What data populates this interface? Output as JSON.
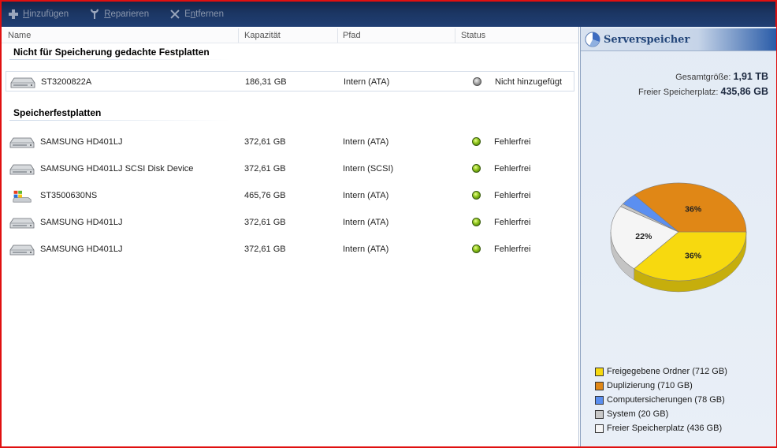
{
  "toolbar": {
    "add": {
      "pre": "",
      "u": "H",
      "post": "inzufügen"
    },
    "repair": {
      "pre": "",
      "u": "R",
      "post": "eparieren"
    },
    "remove": {
      "pre": "E",
      "u": "n",
      "post": "tfernen"
    }
  },
  "columns": {
    "name": "Name",
    "capacity": "Kapazität",
    "path": "Pfad",
    "status": "Status"
  },
  "groups": {
    "not_for_storage": "Nicht für Speicherung gedachte Festplatten",
    "storage": "Speicherfestplatten"
  },
  "disks_not_storage": [
    {
      "name": "ST3200822A",
      "capacity": "186,31 GB",
      "path": "Intern (ATA)",
      "status": "Nicht hinzugefügt",
      "icon": "hard-disk-icon",
      "status_color": "#808080"
    }
  ],
  "disks_storage": [
    {
      "name": "SAMSUNG HD401LJ",
      "capacity": "372,61 GB",
      "path": "Intern (ATA)",
      "status": "Fehlerfrei",
      "icon": "hard-disk-icon",
      "status_color": "#8cc21a"
    },
    {
      "name": "SAMSUNG HD401LJ SCSI Disk Device",
      "capacity": "372,61 GB",
      "path": "Intern (SCSI)",
      "status": "Fehlerfrei",
      "icon": "hard-disk-icon",
      "status_color": "#8cc21a"
    },
    {
      "name": "ST3500630NS",
      "capacity": "465,76 GB",
      "path": "Intern (ATA)",
      "status": "Fehlerfrei",
      "icon": "system-disk-icon",
      "status_color": "#8cc21a"
    },
    {
      "name": "SAMSUNG HD401LJ",
      "capacity": "372,61 GB",
      "path": "Intern (ATA)",
      "status": "Fehlerfrei",
      "icon": "hard-disk-icon",
      "status_color": "#8cc21a"
    },
    {
      "name": "SAMSUNG HD401LJ",
      "capacity": "372,61 GB",
      "path": "Intern (ATA)",
      "status": "Fehlerfrei",
      "icon": "hard-disk-icon",
      "status_color": "#8cc21a"
    }
  ],
  "panel": {
    "title": "Serverspeicher",
    "total_label": "Gesamtgröße:",
    "total_value": "1,91 TB",
    "free_label": "Freier Speicherplatz:",
    "free_value": "435,86 GB"
  },
  "chart_data": {
    "type": "pie",
    "slices": [
      {
        "name": "Freigegebene Ordner (712 GB)",
        "value": 712,
        "label": "36%",
        "color": "#f7d90f"
      },
      {
        "name": "Freier Speicherplatz (436 GB)",
        "value": 436,
        "label": "22%",
        "color": "#f5f5f5"
      },
      {
        "name": "System (20 GB)",
        "value": 20,
        "label": "",
        "color": "#c8c8c8"
      },
      {
        "name": "Computersicherungen (78 GB)",
        "value": 78,
        "label": "",
        "color": "#5b8ff0"
      },
      {
        "name": "Duplizierung (710 GB)",
        "value": 710,
        "label": "36%",
        "color": "#e08716"
      }
    ],
    "legend_order": [
      0,
      4,
      3,
      2,
      1
    ]
  }
}
